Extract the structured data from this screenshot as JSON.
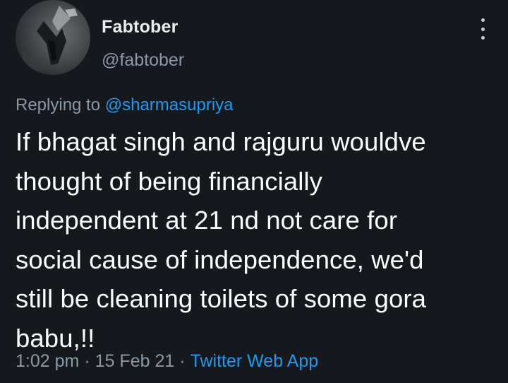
{
  "author": {
    "display_name": "Fabtober",
    "handle": "@fabtober",
    "avatar_icon": "profile-photo"
  },
  "menu": {
    "icon": "more-vertical-icon"
  },
  "reply_context": {
    "prefix": "Replying to",
    "mention": "@sharmasupriya"
  },
  "tweet": {
    "text": "If bhagat singh and rajguru wouldve\nthought of being financially\nindependent at 21 nd not care for\nsocial cause of independence, we'd\nstill be cleaning toilets of some gora\nbabu,!!"
  },
  "meta": {
    "time": "1:02 pm",
    "separator": "·",
    "date": "15 Feb 21",
    "source": "Twitter Web App"
  },
  "colors": {
    "background": "#15181c",
    "text": "#ffffff",
    "secondary": "#8b98a5",
    "accent": "#1d9bf0"
  }
}
